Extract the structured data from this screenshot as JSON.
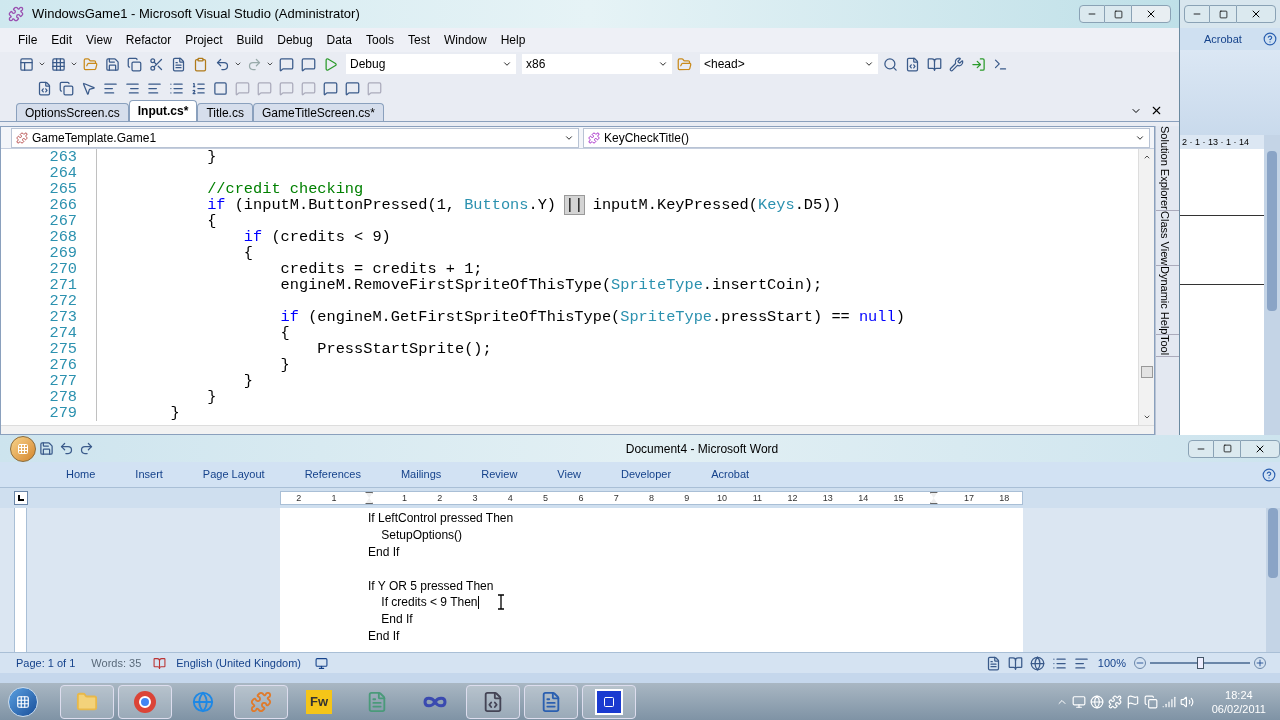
{
  "vs": {
    "title": "WindowsGame1 - Microsoft Visual Studio (Administrator)",
    "menu": [
      "File",
      "Edit",
      "View",
      "Refactor",
      "Project",
      "Build",
      "Debug",
      "Data",
      "Tools",
      "Test",
      "Window",
      "Help"
    ],
    "toolbar": {
      "configuration": "Debug",
      "platform": "x86",
      "find": "<head>"
    },
    "tabs": [
      {
        "label": "OptionsScreen.cs",
        "selected": false
      },
      {
        "label": "Input.cs*",
        "selected": true
      },
      {
        "label": "Title.cs",
        "selected": false
      },
      {
        "label": "GameTitleScreen.cs*",
        "selected": false
      }
    ],
    "nav": {
      "type": "GameTemplate.Game1",
      "member": "KeyCheckTitle()"
    },
    "code": [
      {
        "number": "263",
        "tokens": [
          {
            "text": "            }",
            "kind": "plain"
          }
        ]
      },
      {
        "number": "264"
      },
      {
        "number": "265",
        "tokens": [
          {
            "text": "            //credit checking",
            "kind": "comment"
          }
        ]
      },
      {
        "number": "266",
        "tokens": [
          {
            "text": "            if",
            "kind": "keyword"
          },
          {
            "text": " (inputM.ButtonPressed(1, ",
            "kind": "plain"
          },
          {
            "text": "Buttons",
            "kind": "type"
          },
          {
            "text": ".Y) ",
            "kind": "plain"
          },
          {
            "text": "||",
            "kind": "match"
          },
          {
            "text": " inputM.KeyPressed(",
            "kind": "plain"
          },
          {
            "text": "Keys",
            "kind": "type"
          },
          {
            "text": ".D5))",
            "kind": "plain"
          }
        ]
      },
      {
        "number": "267",
        "tokens": [
          {
            "text": "            {",
            "kind": "plain"
          }
        ]
      },
      {
        "number": "268",
        "tokens": [
          {
            "text": "                if",
            "kind": "keyword"
          },
          {
            "text": " (credits < 9)",
            "kind": "plain"
          }
        ]
      },
      {
        "number": "269",
        "tokens": [
          {
            "text": "                {",
            "kind": "plain"
          }
        ]
      },
      {
        "number": "270",
        "tokens": [
          {
            "text": "                    credits = credits + 1;",
            "kind": "plain"
          }
        ]
      },
      {
        "number": "271",
        "tokens": [
          {
            "text": "                    engineM.RemoveFirstSpriteOfThisType(",
            "kind": "plain"
          },
          {
            "text": "SpriteType",
            "kind": "type"
          },
          {
            "text": ".insertCoin);",
            "kind": "plain"
          }
        ]
      },
      {
        "number": "272"
      },
      {
        "number": "273",
        "tokens": [
          {
            "text": "                    if",
            "kind": "keyword"
          },
          {
            "text": " (engineM.GetFirstSpriteOfThisType(",
            "kind": "plain"
          },
          {
            "text": "SpriteType",
            "kind": "type"
          },
          {
            "text": ".pressStart) == ",
            "kind": "plain"
          },
          {
            "text": "null",
            "kind": "keyword"
          },
          {
            "text": ")",
            "kind": "plain"
          }
        ]
      },
      {
        "number": "274",
        "tokens": [
          {
            "text": "                    {",
            "kind": "plain"
          }
        ]
      },
      {
        "number": "275",
        "tokens": [
          {
            "text": "                        PressStartSprite();",
            "kind": "plain"
          }
        ]
      },
      {
        "number": "276",
        "tokens": [
          {
            "text": "                    }",
            "kind": "plain"
          }
        ]
      },
      {
        "number": "277",
        "tokens": [
          {
            "text": "                }",
            "kind": "plain"
          }
        ]
      },
      {
        "number": "278",
        "tokens": [
          {
            "text": "            }",
            "kind": "plain"
          }
        ]
      },
      {
        "number": "279",
        "tokens": [
          {
            "text": "        }",
            "kind": "plain"
          }
        ]
      }
    ],
    "side_tabs": [
      "Solution Explorer",
      "Class View",
      "Dynamic Help",
      "Tool"
    ]
  },
  "background_window": {
    "tab": "Acrobat",
    "ruler": "2 · 1 · 13 · 1 · 14"
  },
  "word": {
    "title": "Document4 - Microsoft Word",
    "tabs": [
      "Home",
      "Insert",
      "Page Layout",
      "References",
      "Mailings",
      "Review",
      "View",
      "Developer",
      "Acrobat"
    ],
    "ruler": [
      {
        "kind": "number",
        "label": "2"
      },
      {
        "kind": "number",
        "label": "1"
      },
      {
        "kind": "marker"
      },
      {
        "kind": "number",
        "label": "1"
      },
      {
        "kind": "number",
        "label": "2"
      },
      {
        "kind": "number",
        "label": "3"
      },
      {
        "kind": "number",
        "label": "4"
      },
      {
        "kind": "number",
        "label": "5"
      },
      {
        "kind": "number",
        "label": "6"
      },
      {
        "kind": "number",
        "label": "7"
      },
      {
        "kind": "number",
        "label": "8"
      },
      {
        "kind": "number",
        "label": "9"
      },
      {
        "kind": "number",
        "label": "10"
      },
      {
        "kind": "number",
        "label": "11"
      },
      {
        "kind": "number",
        "label": "12"
      },
      {
        "kind": "number",
        "label": "13"
      },
      {
        "kind": "number",
        "label": "14"
      },
      {
        "kind": "number",
        "label": "15"
      },
      {
        "kind": "marker"
      },
      {
        "kind": "number",
        "label": "17"
      },
      {
        "kind": "number",
        "label": "18"
      }
    ],
    "lines": [
      {
        "kind": "text",
        "text": "If LeftControl pressed Then",
        "caret": false
      },
      {
        "kind": "text",
        "text": "\tSetupOptions()",
        "caret": false
      },
      {
        "kind": "text",
        "text": "End If",
        "caret": false
      },
      {
        "kind": "blank"
      },
      {
        "kind": "text",
        "text": "If Y OR 5 pressed Then",
        "caret": false
      },
      {
        "kind": "text",
        "text": "\tIf credits < 9 Then",
        "caret": true
      },
      {
        "kind": "text",
        "text": "\tEnd If",
        "caret": false
      },
      {
        "kind": "text",
        "text": "End If",
        "caret": false
      }
    ],
    "status": {
      "page": "Page: 1 of 1",
      "words": "Words: 35",
      "language": "English (United Kingdom)",
      "zoom": "100%",
      "zoom_slider": {
        "level": 0.5
      }
    }
  },
  "taskbar": {
    "app_label": "Fw",
    "time": "18:24",
    "date": "06/02/2011"
  }
}
